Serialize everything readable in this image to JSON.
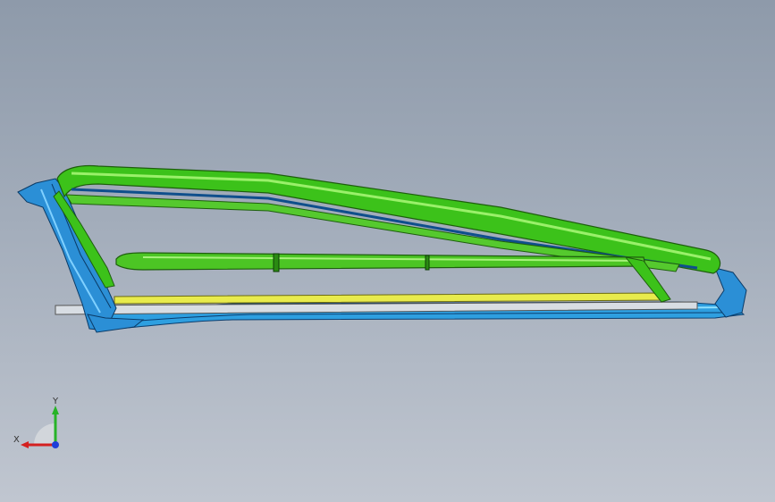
{
  "triad": {
    "x_label": "X",
    "y_label": "Y"
  },
  "colors": {
    "background_top": "#8e9aaa",
    "background_bottom": "#c0c6d0",
    "frame_green": "#3cc21a",
    "frame_green_dark": "#1d6b0c",
    "frame_blue": "#2b8fd6",
    "frame_cyan": "#38b8ea",
    "rail_yellow": "#e6e84a",
    "axis_x": "#d42020",
    "axis_y": "#27b327",
    "axis_z": "#1f3fd9"
  },
  "model": {
    "description_icon": "sunroof-frame-3d-model"
  }
}
